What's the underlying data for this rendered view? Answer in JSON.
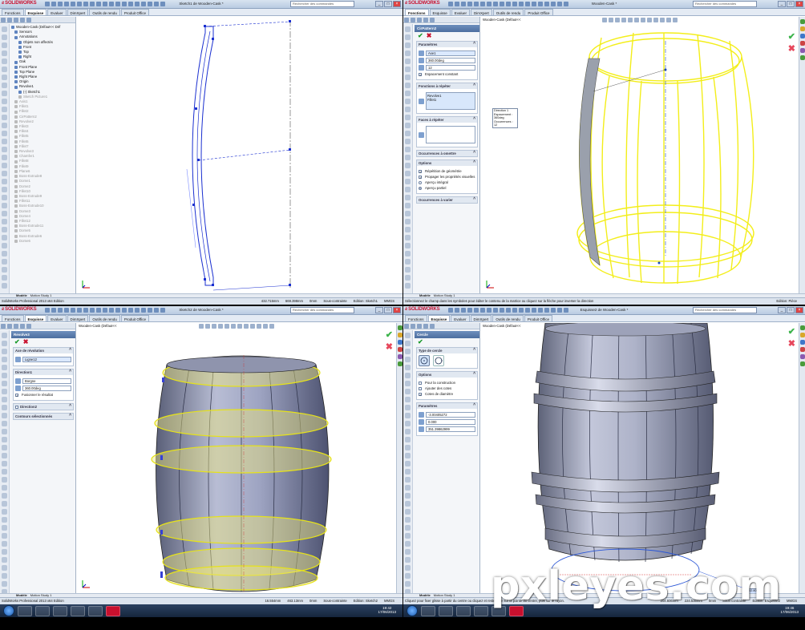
{
  "app": {
    "logo_text": "SOLIDWORKS",
    "search_placeholder": "Rechercher des commandes",
    "edition": "SolidWorks Professional 2013 x64 Edition",
    "tabs": [
      "Fonctions",
      "Esquisse",
      "Evaluer",
      "DimXpert",
      "Outils de rendu",
      "Produit Office"
    ],
    "bottom_tabs": [
      "Modèle",
      "Motion Study 1"
    ]
  },
  "q1": {
    "title": "Sketch1 de Wooden-Cask *",
    "tree": [
      {
        "label": "Wooden-Cask (Défaut<< Déf",
        "indent": 0,
        "grey": false
      },
      {
        "label": "Sensors",
        "indent": 1,
        "grey": false
      },
      {
        "label": "Annotations",
        "indent": 1,
        "grey": false
      },
      {
        "label": "Objets non affectés",
        "indent": 2,
        "grey": false
      },
      {
        "label": "Front",
        "indent": 2,
        "grey": false
      },
      {
        "label": "Top",
        "indent": 2,
        "grey": false
      },
      {
        "label": "Right",
        "indent": 2,
        "grey": false
      },
      {
        "label": "Oak",
        "indent": 1,
        "grey": false
      },
      {
        "label": "Front Plane",
        "indent": 1,
        "grey": false
      },
      {
        "label": "Top Plane",
        "indent": 1,
        "grey": false
      },
      {
        "label": "Right Plane",
        "indent": 1,
        "grey": false
      },
      {
        "label": "Origin",
        "indent": 1,
        "grey": false
      },
      {
        "label": "Revolve1",
        "indent": 1,
        "grey": false
      },
      {
        "label": "(-) Sketch1",
        "indent": 2,
        "grey": false
      },
      {
        "label": "Sketch Picture1",
        "indent": 2,
        "grey": true
      },
      {
        "label": "Axis1",
        "indent": 1,
        "grey": true
      },
      {
        "label": "Fillet1",
        "indent": 1,
        "grey": true
      },
      {
        "label": "Fillet2",
        "indent": 1,
        "grey": true
      },
      {
        "label": "CirPattern2",
        "indent": 1,
        "grey": true
      },
      {
        "label": "Revolve2",
        "indent": 1,
        "grey": true
      },
      {
        "label": "Fillet3",
        "indent": 1,
        "grey": true
      },
      {
        "label": "Fillet4",
        "indent": 1,
        "grey": true
      },
      {
        "label": "Fillet5",
        "indent": 1,
        "grey": true
      },
      {
        "label": "Fillet6",
        "indent": 1,
        "grey": true
      },
      {
        "label": "Fillet7",
        "indent": 1,
        "grey": true
      },
      {
        "label": "Revolve3",
        "indent": 1,
        "grey": true
      },
      {
        "label": "Chamfer1",
        "indent": 1,
        "grey": true
      },
      {
        "label": "Fillet8",
        "indent": 1,
        "grey": true
      },
      {
        "label": "Fillet9",
        "indent": 1,
        "grey": true
      },
      {
        "label": "Plane6",
        "indent": 1,
        "grey": true
      },
      {
        "label": "Boss-Extrude8",
        "indent": 1,
        "grey": true
      },
      {
        "label": "Dome1",
        "indent": 1,
        "grey": true
      },
      {
        "label": "Dome2",
        "indent": 1,
        "grey": true
      },
      {
        "label": "Fillet10",
        "indent": 1,
        "grey": true
      },
      {
        "label": "Boss-Extrude9",
        "indent": 1,
        "grey": true
      },
      {
        "label": "Fillet11",
        "indent": 1,
        "grey": true
      },
      {
        "label": "Boss-Extrude10",
        "indent": 1,
        "grey": true
      },
      {
        "label": "Dome3",
        "indent": 1,
        "grey": true
      },
      {
        "label": "Dome4",
        "indent": 1,
        "grey": true
      },
      {
        "label": "Fillet12",
        "indent": 1,
        "grey": true
      },
      {
        "label": "Boss-Extrude11",
        "indent": 1,
        "grey": true
      },
      {
        "label": "Dome5",
        "indent": 1,
        "grey": true
      },
      {
        "label": "Boss-Extrude6",
        "indent": 1,
        "grey": true
      },
      {
        "label": "Dome6",
        "indent": 1,
        "grey": true
      }
    ],
    "status_left": "SolidWorks Professional 2013 x64 Edition",
    "status_x": "432.715mm",
    "status_y": "669.398mm",
    "status_z": "0mm",
    "status_state": "Sous-contrainte",
    "status_edit": "Edition: Sketch1",
    "units": "MMGS"
  },
  "q2": {
    "title": "Wooden-Cask *",
    "breadcrumb": "Wooden-Cask (Défaut<<",
    "pm_title": "CirPattern2",
    "param_group": "Paramètres",
    "axis": "Axe1",
    "angle": "360.00deg",
    "count": "12",
    "equal_spacing": "Espacement constant",
    "features_group": "Fonctions à répéter",
    "features": [
      "Revolve1",
      "Fillet1"
    ],
    "faces_group": "Faces à répéter",
    "skip_group": "Occurrences à omettre",
    "options_group": "Options",
    "opt_geometry": "Répétition de géométrie",
    "opt_propagate": "Propager les propriétés visuelles",
    "opt_full": "Aperçu intégral",
    "opt_partial": "Aperçu partiel",
    "vary_group": "Occurrences à varier",
    "callout": [
      "Direction 1",
      "Espacement : 360deg",
      "Occurrences : 12"
    ],
    "status_left": "Sélectionnez le champ dans les symboles pour éditer le contenu de la matrice ou cliquez sur la flèche pour inverser la direction",
    "status_edit": "Edition: Pièce"
  },
  "q3": {
    "title": "Sketch2 de Wooden-Cask *",
    "breadcrumb": "Wooden-Cask (Défaut<<",
    "pm_title": "Revolve3",
    "axis_group": "Axe de révolution",
    "axis": "Ligne12",
    "dir1_group": "Direction1",
    "dir_type": "Borgne",
    "angle": "360.00deg",
    "merge": "Fusionner le résultat",
    "dir2_group": "Direction2",
    "contours_group": "Contours sélectionnés",
    "status_left": "SolidWorks Professional 2013 x64 Edition",
    "status_x": "16.554mm",
    "status_y": "463.13mm",
    "status_z": "0mm",
    "status_state": "Sous-contrainte",
    "status_edit": "Edition: Sketch2",
    "units": "MMGS",
    "clock_time": "19:42",
    "clock_date": "17/06/2013"
  },
  "q4": {
    "title": "Esquisse2 de Wooden-Cask *",
    "breadcrumb": "Wooden-Cask (Défaut<<",
    "pm_title": "Cercle",
    "type_group": "Type de cercle",
    "options_group": "Options",
    "opt_construction": "Pour la construction",
    "opt_dimensions": "Ajouter des cotes",
    "opt_diameter": "Cotes de diamètre",
    "params_group": "Paramètres",
    "param_x": "-3.00405272",
    "param_y": "0.000",
    "param_r": "351.39862999",
    "dim_value": "702.80",
    "status_left": "Cliquez pour fixer glisse à partir du centre ou cliquez et restez fixe sur la pointe du centre, puis sur le rayon.",
    "status_x": "204.606mm",
    "status_y": "224.536mm",
    "status_z": "0mm",
    "status_state": "Sous-contrainte",
    "status_edit": "Edition: Esquisse2",
    "units": "MMGS",
    "clock_time": "19:46",
    "clock_date": "17/06/2013"
  },
  "watermark": "pxleyes.com"
}
